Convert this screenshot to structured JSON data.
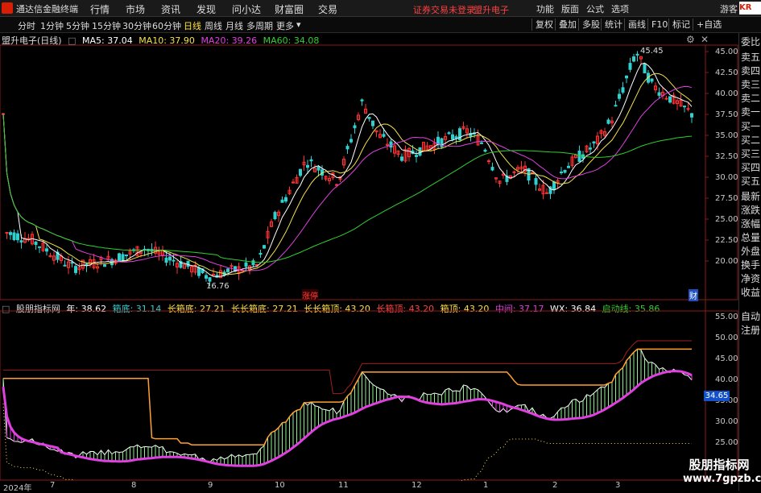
{
  "app": {
    "title": "通达信金融终端"
  },
  "menu": [
    "行情",
    "市场",
    "资讯",
    "发现",
    "问小达",
    "财富圈",
    "交易"
  ],
  "warning": "证券交易未登录",
  "stock_name_top": "盟升电子",
  "topright": [
    "功能",
    "版面",
    "公式",
    "选项",
    "游客"
  ],
  "badge": "KR",
  "periods": [
    "分时",
    "1分钟",
    "5分钟",
    "15分钟",
    "30分钟",
    "60分钟",
    "日线",
    "周线",
    "月线",
    "多周期",
    "更多"
  ],
  "active_period": "日线",
  "tools": [
    "复权",
    "叠加",
    "多股",
    "统计",
    "画线",
    "F10",
    "标记",
    "+自选"
  ],
  "price_panel": {
    "title": "盟升电子(日线)",
    "ma": [
      {
        "label": "MA5: 37.04",
        "color": "#ffffff"
      },
      {
        "label": "MA10: 37.90",
        "color": "#f5e14b"
      },
      {
        "label": "MA20: 39.26",
        "color": "#e040e0"
      },
      {
        "label": "MA60: 34.08",
        "color": "#30d030"
      }
    ],
    "high_label": "45.45",
    "low_label": "16.76",
    "event_tag": "涨停",
    "event_tag2": "财",
    "y_ticks": [
      "45.00",
      "42.50",
      "40.00",
      "37.50",
      "35.00",
      "32.50",
      "30.00",
      "27.50",
      "25.00",
      "22.50",
      "20.00"
    ]
  },
  "indicator_panel": {
    "title": "股朋指标网",
    "items": [
      {
        "label": "年: 38.62",
        "color": "#ffffff"
      },
      {
        "label": "箱底: 31.14",
        "color": "#30d0d0"
      },
      {
        "label": "长箱底: 27.21",
        "color": "#ffe040"
      },
      {
        "label": "长长箱底: 27.21",
        "color": "#ffe040"
      },
      {
        "label": "长长箱顶: 43.20",
        "color": "#ffe040"
      },
      {
        "label": "长箱顶: 43.20",
        "color": "#ff4040"
      },
      {
        "label": "箱顶: 43.20",
        "color": "#ffe040"
      },
      {
        "label": "中间: 37.17",
        "color": "#e040e0"
      },
      {
        "label": "WX: 36.84",
        "color": "#ffffff"
      },
      {
        "label": "启动线: 35.86",
        "color": "#30d030"
      }
    ],
    "current_value": "34.65",
    "y_ticks": [
      "55.00",
      "50.00",
      "45.00",
      "40.00",
      "35.00",
      "30.00",
      "25.00"
    ]
  },
  "right_tabs": [
    "委比",
    "卖五",
    "卖四",
    "卖三",
    "卖二",
    "卖一",
    "买一",
    "买二",
    "买三",
    "买四",
    "买五",
    "最新",
    "涨跌",
    "涨幅",
    "总量",
    "外盘",
    "换手",
    "净资",
    "收益"
  ],
  "right_tabs_bottom": [
    "自动",
    "注册"
  ],
  "x_axis": [
    "2024年",
    "7",
    "8",
    "9",
    "10",
    "11",
    "12",
    "1",
    "2",
    "3"
  ],
  "watermark": {
    "line1": "股朋指标网",
    "line2": "www.7gpzb.com"
  },
  "colors": {
    "up": "#ff3333",
    "down": "#30d0d0",
    "ma5": "#ffffff",
    "ma10": "#f5e14b",
    "ma20": "#e040e0",
    "ma60": "#30d030"
  }
}
